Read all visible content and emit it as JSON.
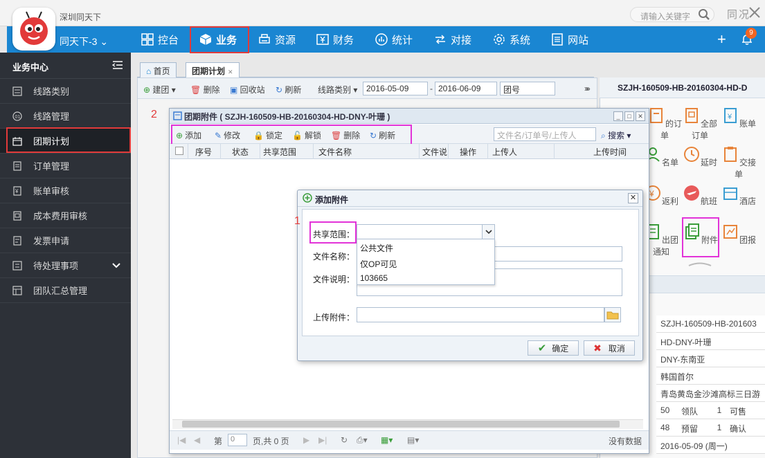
{
  "app": {
    "name": "深圳同天下",
    "brand_label": "同天下-3 ⌄",
    "search_placeholder": "请输入关键字",
    "user_badge": "同况",
    "notification_count": "9"
  },
  "topnav": {
    "items": [
      "控台",
      "业务",
      "资源",
      "财务",
      "统计",
      "对接",
      "系统",
      "网站"
    ],
    "active": "业务"
  },
  "sidebar": {
    "title": "业务中心",
    "items": [
      "线路类别",
      "线路管理",
      "团期计划",
      "订单管理",
      "账单审核",
      "成本费用审核",
      "发票申请",
      "待处理事项",
      "团队汇总管理"
    ],
    "active": "团期计划"
  },
  "tabs": [
    "首页",
    "团期计划"
  ],
  "bg_toolbar": {
    "build": "建团",
    "delete": "删除",
    "recycle": "回收站",
    "refresh": "刷新",
    "route_type": "线路类别",
    "date_from": "2016-05-09",
    "date_sep": "-",
    "date_to": "2016-06-09",
    "group_no": "团号",
    "more": "»"
  },
  "right_panel": {
    "title": "SZJH-160509-HB-20160304-HD-D",
    "more": "»",
    "grid": [
      "的订单",
      "全部订单",
      "账单",
      "名单",
      "延时",
      "交接单",
      "返利",
      "航班",
      "酒店",
      "出团通知",
      "附件",
      "团报"
    ],
    "info_rows": [
      "SZJH-160509-HB-201603",
      "HD-DNY-叶珊",
      "DNY-东南亚",
      "韩国首尔",
      "青岛黄岛金沙滩高标三日游"
    ],
    "stats1": [
      "50",
      "领队",
      "1",
      "可售"
    ],
    "stats2": [
      "48",
      "预留",
      "1",
      "确认"
    ],
    "date_row": "2016-05-09 (周一)"
  },
  "attach_window": {
    "title": "团期附件 ( SZJH-160509-HB-20160304-HD-DNY-叶珊 )",
    "toolbar": [
      "添加",
      "修改",
      "锁定",
      "解锁",
      "删除",
      "刷新"
    ],
    "search_placeholder": "文件名/订单号/上传人",
    "search_btn": "搜索",
    "columns": [
      "序号",
      "状态",
      "共享范围",
      "文件名称",
      "文件说",
      "操作",
      "上传人",
      "上传时间"
    ],
    "pager": {
      "page_label": "第",
      "page_value": "0",
      "total": "页,共 0 页",
      "empty": "没有数据"
    }
  },
  "add_dialog": {
    "title": "添加附件",
    "scope_label": "共享范围：",
    "name_label": "文件名称：",
    "desc_label": "文件说明：",
    "upload_label": "上传附件：",
    "scope_options": [
      "公共文件",
      "仅OP可见",
      "103665"
    ],
    "ok": "确定",
    "cancel": "取消"
  },
  "markers": {
    "one": "1",
    "two": "2"
  },
  "colors": {
    "nav_blue": "#1a86d2",
    "sidebar_bg": "#2d3138",
    "highlight_red": "#e23a3a",
    "highlight_magenta": "#e233d8",
    "icon_orange": "#e8843a"
  }
}
